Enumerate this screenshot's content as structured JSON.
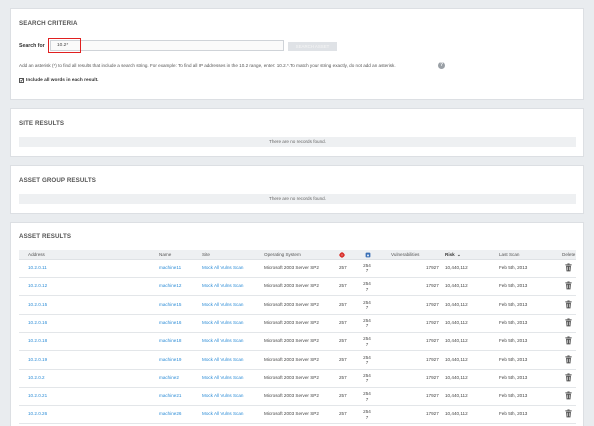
{
  "search_panel": {
    "title": "SEARCH CRITERIA",
    "search_label": "Search for",
    "search_value": "10.2*",
    "search_button": "SEARCH ASSET",
    "help_text": "Add an asterisk (*) to find all results that include a search string. For example: To find all IP addresses in the 10.2 range, enter: 10.2.*.To match your string exactly, do not add an asterisk.",
    "help_icon": "?",
    "checkbox_mark": "✔",
    "checkbox_label": "Include all words in each result."
  },
  "site_panel": {
    "title": "SITE RESULTS",
    "empty_text": "There are no records found."
  },
  "group_panel": {
    "title": "ASSET GROUP RESULTS",
    "empty_text": "There are no records found."
  },
  "asset_panel": {
    "title": "ASSET RESULTS",
    "columns": {
      "address": "Address",
      "name": "Name",
      "site": "Site",
      "os": "Operating System",
      "vulnerabilities": "Vulnerabilities",
      "risk": "Risk",
      "risk_sort": "⌄",
      "last_scan": "Last Scan",
      "delete": "Delete"
    },
    "rows": [
      {
        "address": "10.2.0.11",
        "name": "machine11",
        "site": "Mock All Vulns Scan",
        "os": "Microsoft 2003 Server SP2",
        "exploits": "257",
        "malware_top": "254",
        "malware_bottom": "7",
        "vulns": "17927",
        "risk": "10,440,112",
        "last_scan": "Feb 5th, 2013"
      },
      {
        "address": "10.2.0.12",
        "name": "machine12",
        "site": "Mock All Vulns Scan",
        "os": "Microsoft 2003 Server SP2",
        "exploits": "257",
        "malware_top": "254",
        "malware_bottom": "7",
        "vulns": "17927",
        "risk": "10,440,112",
        "last_scan": "Feb 5th, 2013"
      },
      {
        "address": "10.2.0.15",
        "name": "machine15",
        "site": "Mock All Vulns Scan",
        "os": "Microsoft 2003 Server SP2",
        "exploits": "257",
        "malware_top": "254",
        "malware_bottom": "7",
        "vulns": "17927",
        "risk": "10,440,112",
        "last_scan": "Feb 5th, 2013"
      },
      {
        "address": "10.2.0.16",
        "name": "machine16",
        "site": "Mock All Vulns Scan",
        "os": "Microsoft 2003 Server SP2",
        "exploits": "257",
        "malware_top": "254",
        "malware_bottom": "7",
        "vulns": "17927",
        "risk": "10,440,112",
        "last_scan": "Feb 5th, 2013"
      },
      {
        "address": "10.2.0.18",
        "name": "machine18",
        "site": "Mock All Vulns Scan",
        "os": "Microsoft 2003 Server SP2",
        "exploits": "257",
        "malware_top": "254",
        "malware_bottom": "7",
        "vulns": "17927",
        "risk": "10,440,112",
        "last_scan": "Feb 5th, 2013"
      },
      {
        "address": "10.2.0.19",
        "name": "machine19",
        "site": "Mock All Vulns Scan",
        "os": "Microsoft 2003 Server SP2",
        "exploits": "257",
        "malware_top": "254",
        "malware_bottom": "7",
        "vulns": "17927",
        "risk": "10,440,112",
        "last_scan": "Feb 5th, 2013"
      },
      {
        "address": "10.2.0.2",
        "name": "machine2",
        "site": "Mock All Vulns Scan",
        "os": "Microsoft 2003 Server SP2",
        "exploits": "257",
        "malware_top": "254",
        "malware_bottom": "7",
        "vulns": "17927",
        "risk": "10,440,112",
        "last_scan": "Feb 5th, 2013"
      },
      {
        "address": "10.2.0.21",
        "name": "machine21",
        "site": "Mock All Vulns Scan",
        "os": "Microsoft 2003 Server SP2",
        "exploits": "257",
        "malware_top": "254",
        "malware_bottom": "7",
        "vulns": "17927",
        "risk": "10,440,112",
        "last_scan": "Feb 5th, 2013"
      },
      {
        "address": "10.2.0.26",
        "name": "machine26",
        "site": "Mock All Vulns Scan",
        "os": "Microsoft 2003 Server SP2",
        "exploits": "257",
        "malware_top": "254",
        "malware_bottom": "7",
        "vulns": "17927",
        "risk": "10,440,112",
        "last_scan": "Feb 5th, 2013"
      }
    ],
    "icons": {
      "exploit_icon": "exploit-icon",
      "malware_icon": "malware-icon",
      "delete_icon": "trash-icon"
    }
  },
  "colors": {
    "link": "#2a8bd6",
    "highlight": "#e02020",
    "exploit": "#d9302c",
    "malware": "#3a6fb5"
  }
}
